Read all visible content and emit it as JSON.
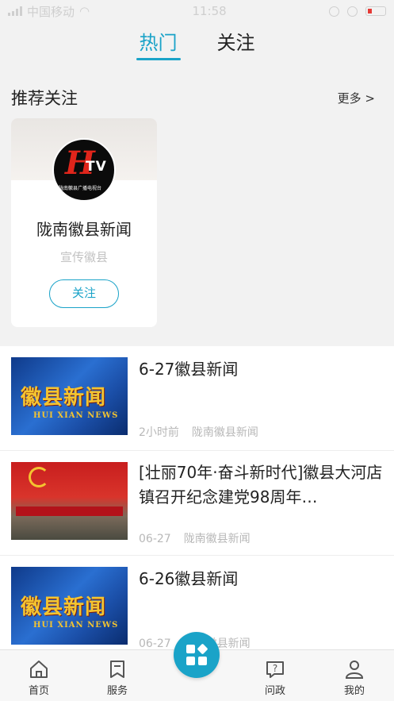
{
  "status": {
    "carrier": "中国移动",
    "time": "11:58"
  },
  "tabs": [
    {
      "label": "热门"
    },
    {
      "label": "关注"
    }
  ],
  "recommend": {
    "title": "推荐关注",
    "more": "更多 >",
    "card": {
      "name": "陇南徽县新闻",
      "desc": "宣传徽县",
      "follow": "关注",
      "logo_tv": "TV",
      "logo_sub": "陇南徽县广播电视台"
    }
  },
  "news": [
    {
      "title": "6-27徽县新闻",
      "time": "2小时前",
      "source": "陇南徽县新闻",
      "thumb_big": "徽县新闻",
      "thumb_small": "HUI XIAN NEWS"
    },
    {
      "title": "[壮丽70年·奋斗新时代]徽县大河店镇召开纪念建党98周年…",
      "time": "06-27",
      "source": "陇南徽县新闻"
    },
    {
      "title": "6-26徽县新闻",
      "time": "06-27",
      "source": "陇南徽县新闻",
      "thumb_big": "徽县新闻",
      "thumb_small": "HUI XIAN NEWS"
    }
  ],
  "tabbar": [
    {
      "label": "首页"
    },
    {
      "label": "服务"
    },
    {
      "label": "问政"
    },
    {
      "label": "我的"
    }
  ],
  "colors": {
    "accent": "#1aa3c8"
  }
}
